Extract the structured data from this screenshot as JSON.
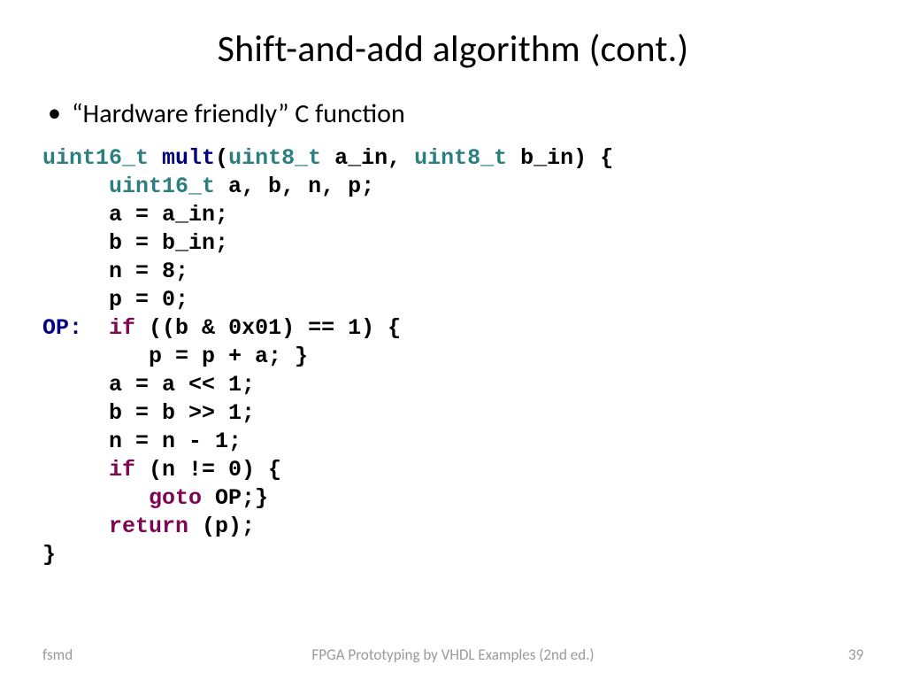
{
  "title": "Shift-and-add algorithm (cont.)",
  "bullet": "“Hardware friendly” C function",
  "code": {
    "l1_a": "uint16_t",
    "l1_b": " ",
    "l1_c": "mult",
    "l1_d": "(",
    "l1_e": "uint8_t",
    "l1_f": " a_in, ",
    "l1_g": "uint8_t",
    "l1_h": " b_in) {",
    "l2_a": "     ",
    "l2_b": "uint16_t",
    "l2_c": " a, b, n, p;",
    "l3": "     a = a_in;",
    "l4": "     b = b_in;",
    "l5": "     n = 8;",
    "l6": "     p = 0;",
    "l7_a": "OP:",
    "l7_b": "  ",
    "l7_c": "if",
    "l7_d": " ((b & 0x01) == 1) {",
    "l8": "        p = p + a; }",
    "l9": "     a = a << 1;",
    "l10": "     b = b >> 1;",
    "l11": "     n = n - 1;",
    "l12_a": "     ",
    "l12_b": "if",
    "l12_c": " (n != 0) {",
    "l13_a": "        ",
    "l13_b": "goto",
    "l13_c": " OP;}",
    "l14_a": "     ",
    "l14_b": "return",
    "l14_c": " (p);",
    "l15": "}"
  },
  "footer": {
    "left": "fsmd",
    "center": "FPGA Prototyping by VHDL Examples (2nd ed.)",
    "right": "39"
  }
}
